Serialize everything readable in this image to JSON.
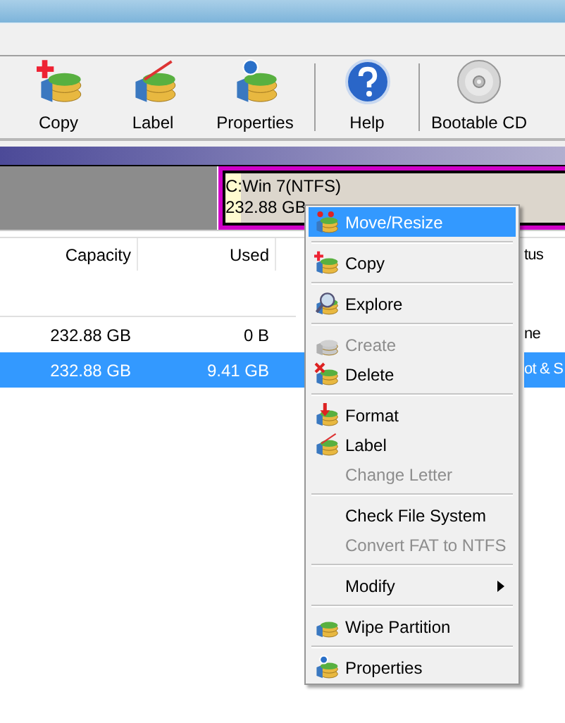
{
  "toolbar": [
    {
      "label": "Copy"
    },
    {
      "label": "Label"
    },
    {
      "label": "Properties"
    },
    {
      "label": "Help"
    },
    {
      "label": "Bootable CD"
    }
  ],
  "disk_map": {
    "partition": {
      "name": "C:Win 7(NTFS)",
      "size": "232.88 GB",
      "selected": true
    }
  },
  "table": {
    "columns": [
      "Capacity",
      "Used",
      "tus"
    ],
    "rows": [
      {
        "cells": [
          "232.88 GB",
          "0 B",
          "ne"
        ],
        "selected": false
      },
      {
        "cells": [
          "232.88 GB",
          "9.41 GB",
          "ot & S"
        ],
        "selected": true
      }
    ]
  },
  "context_menu": {
    "items": [
      {
        "kind": "item",
        "label": "Move/Resize",
        "disabled": false,
        "selected": true
      },
      {
        "kind": "separator"
      },
      {
        "kind": "item",
        "label": "Copy",
        "disabled": false,
        "selected": false
      },
      {
        "kind": "separator"
      },
      {
        "kind": "item",
        "label": "Explore",
        "disabled": false,
        "selected": false
      },
      {
        "kind": "separator"
      },
      {
        "kind": "item",
        "label": "Create",
        "disabled": true,
        "selected": false
      },
      {
        "kind": "item",
        "label": "Delete",
        "disabled": false,
        "selected": false
      },
      {
        "kind": "separator"
      },
      {
        "kind": "item",
        "label": "Format",
        "disabled": false,
        "selected": false
      },
      {
        "kind": "item",
        "label": "Label",
        "disabled": false,
        "selected": false
      },
      {
        "kind": "item",
        "label": "Change Letter",
        "disabled": true,
        "selected": false
      },
      {
        "kind": "separator"
      },
      {
        "kind": "item",
        "label": "Check File System",
        "disabled": false,
        "selected": false
      },
      {
        "kind": "item",
        "label": "Convert FAT to NTFS",
        "disabled": true,
        "selected": false
      },
      {
        "kind": "separator"
      },
      {
        "kind": "item",
        "label": "Modify",
        "disabled": false,
        "selected": false,
        "submenu": true
      },
      {
        "kind": "separator"
      },
      {
        "kind": "item",
        "label": "Wipe Partition",
        "disabled": false,
        "selected": false
      },
      {
        "kind": "separator"
      },
      {
        "kind": "item",
        "label": "Properties",
        "disabled": false,
        "selected": false
      }
    ]
  }
}
